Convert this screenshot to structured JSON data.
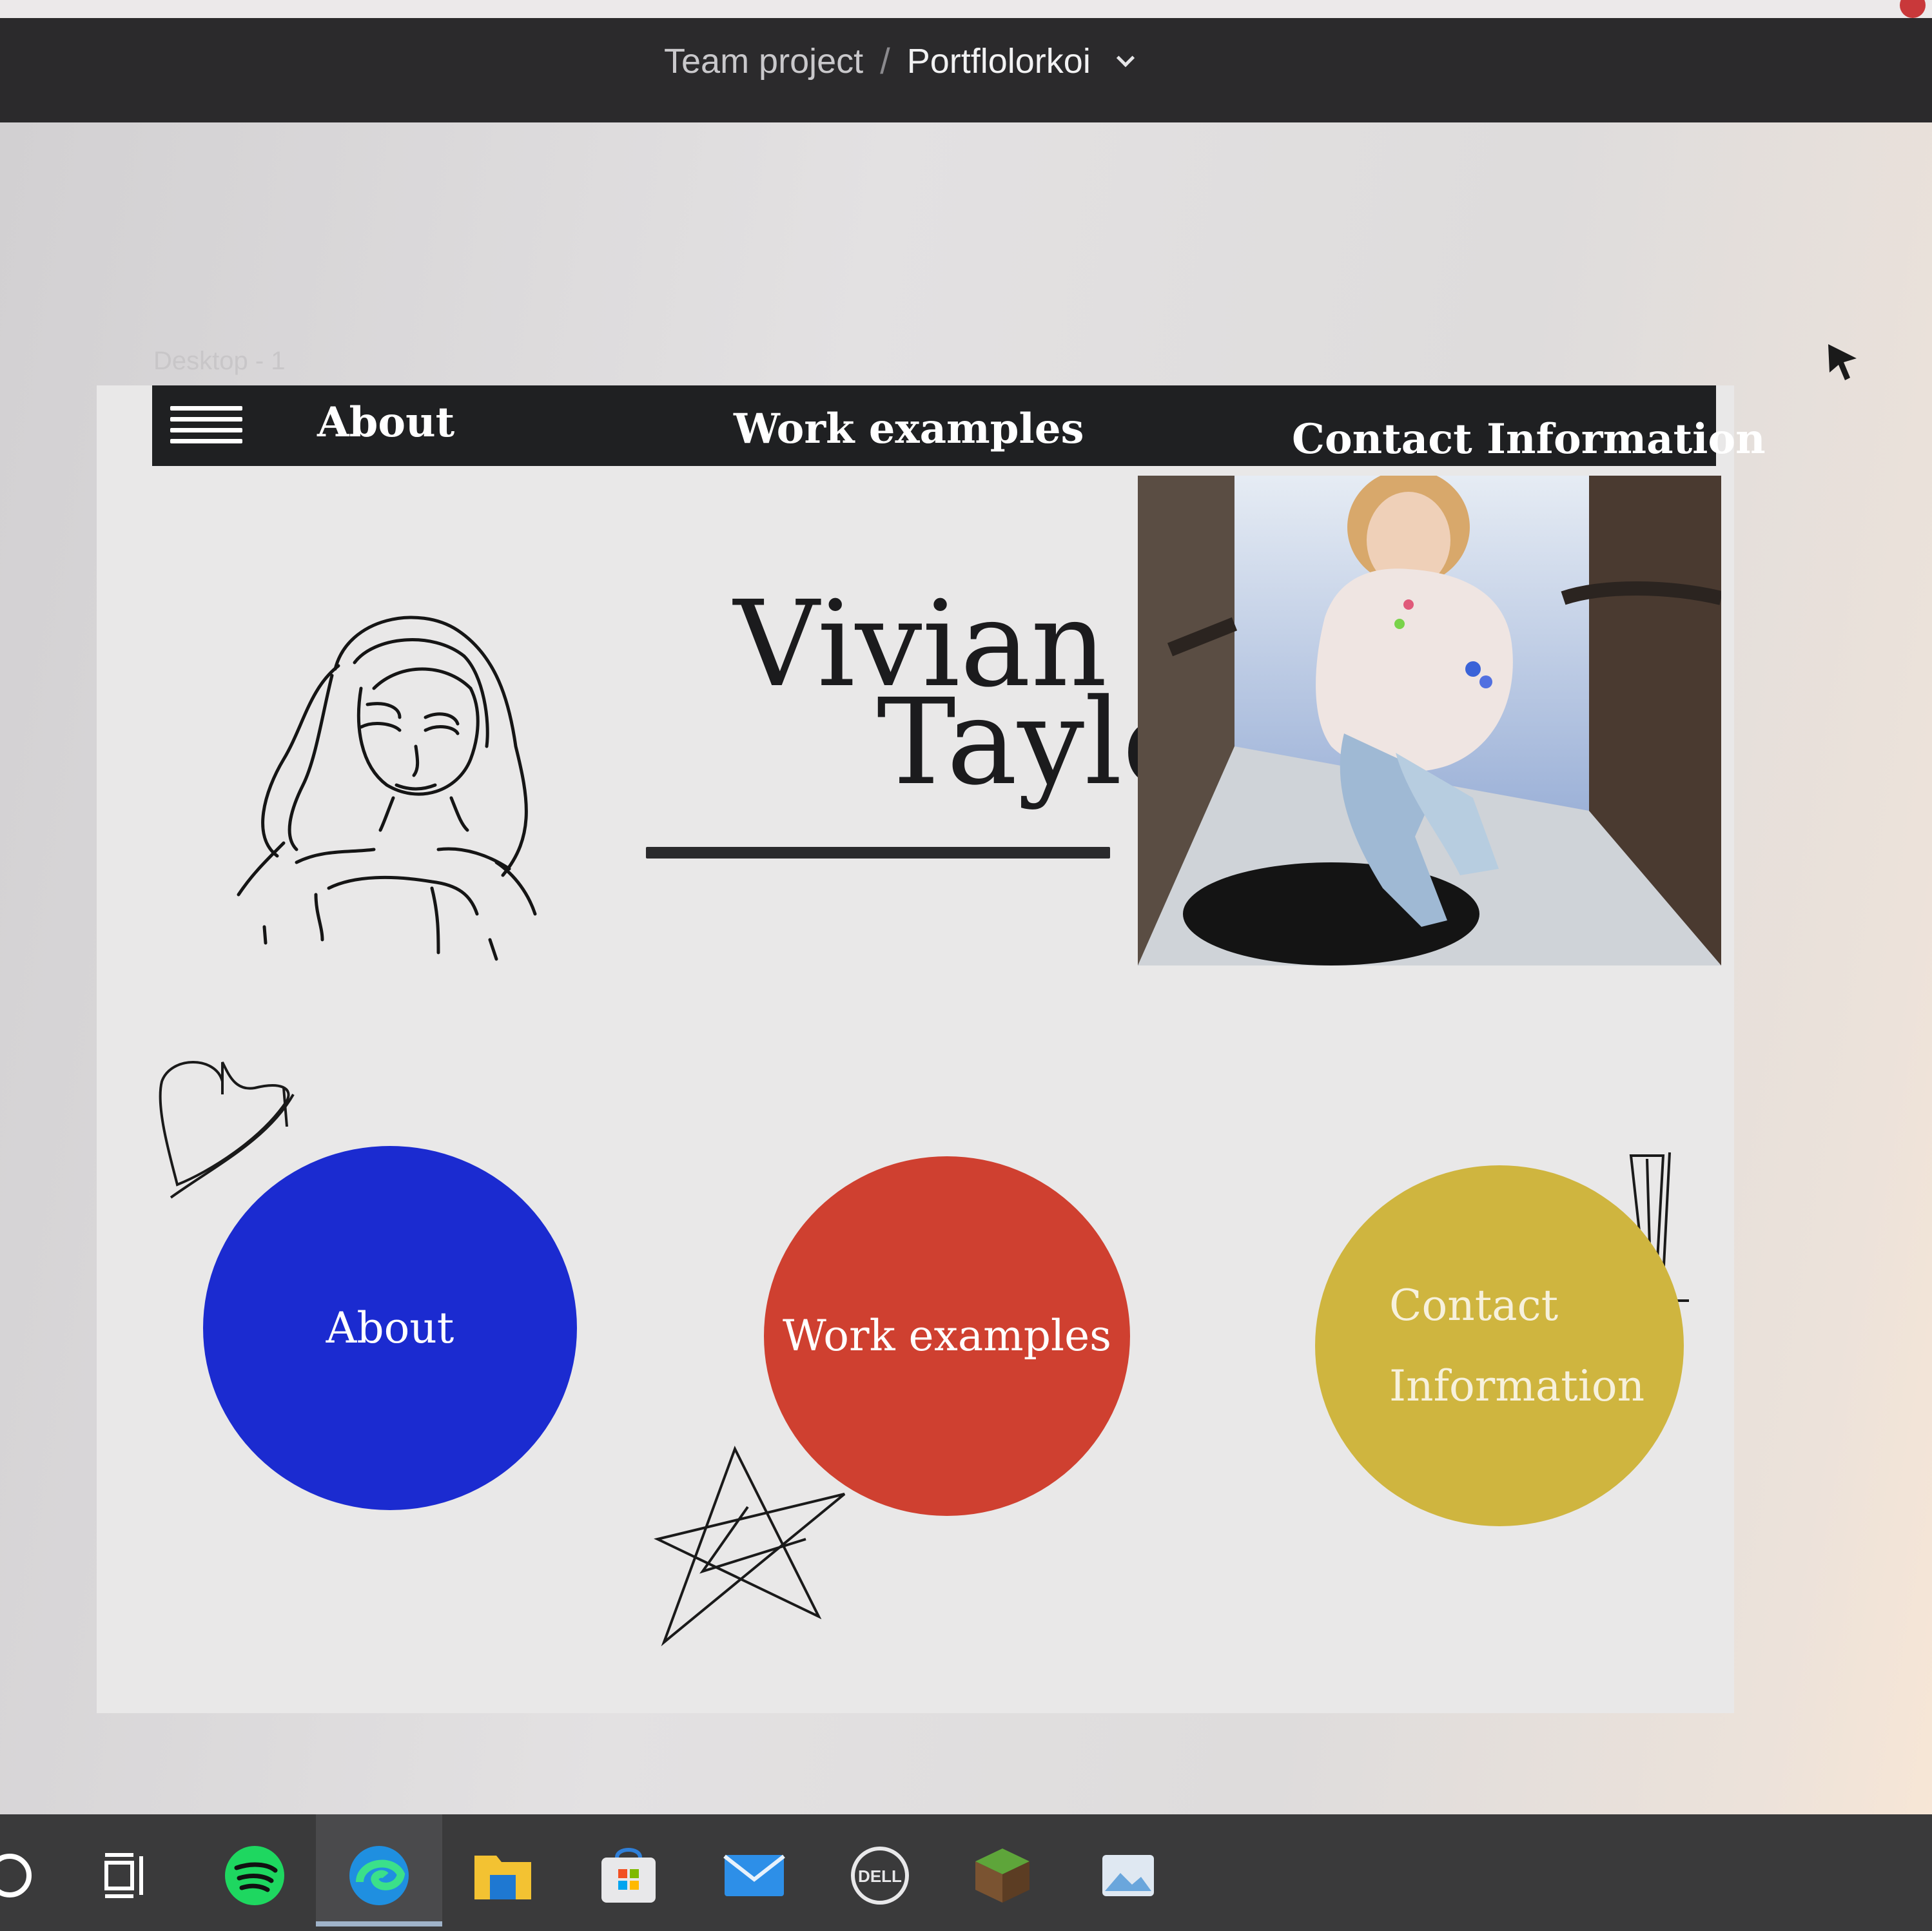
{
  "editor": {
    "breadcrumb_team": "Team project",
    "breadcrumb_separator": "/",
    "breadcrumb_file": "Portflolorkoi",
    "frame_label": "Desktop - 1"
  },
  "site": {
    "nav": {
      "about": "About",
      "work": "Work examples",
      "contact": "Contact Information"
    },
    "name_first": "Vivian",
    "name_last": "Taylor",
    "circles": {
      "about": "About",
      "work": "Work examples",
      "contact_line1": "Contact",
      "contact_line2": "Information"
    }
  },
  "colors": {
    "about_circle": "#1b2bd0",
    "work_circle": "#cf4030",
    "contact_circle": "#cfb53f",
    "nav_bar": "#1f2022"
  },
  "taskbar": {
    "icons": [
      "search-icon",
      "task-view-icon",
      "spotify-icon",
      "edge-icon",
      "file-explorer-icon",
      "microsoft-store-icon",
      "mail-icon",
      "dell-icon",
      "minecraft-icon",
      "photos-icon"
    ]
  }
}
